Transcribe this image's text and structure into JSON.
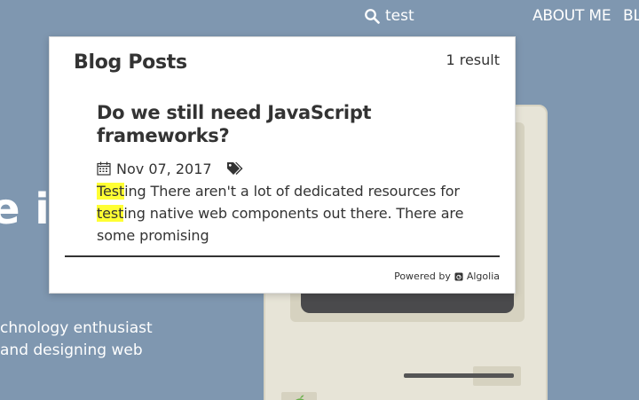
{
  "nav": {
    "search_query": "test",
    "about_label": "ABOUT ME",
    "blog_label": "BL"
  },
  "hero": {
    "heading_fragment": "e is",
    "tagline_line1": "chnology enthusiast",
    "tagline_line2": "and designing web"
  },
  "results": {
    "section_title": "Blog Posts",
    "count": "1 result",
    "items": [
      {
        "title": "Do we still need JavaScript frameworks?",
        "date": "Nov 07, 2017",
        "excerpt": {
          "hl1": "Test",
          "part1": "ing There aren't a lot of dedicated resources for ",
          "hl2": "test",
          "part2": "ing native web components out there. There are some promising"
        }
      }
    ],
    "powered_by_label": "Powered by",
    "provider_name": "Algolia"
  },
  "colors": {
    "background": "#7f97b0",
    "highlight": "#ffff33",
    "panel": "#ffffff",
    "text": "#333333"
  },
  "icons": [
    "search-icon",
    "calendar-icon",
    "tag-icon",
    "algolia-icon",
    "apple-icon"
  ]
}
